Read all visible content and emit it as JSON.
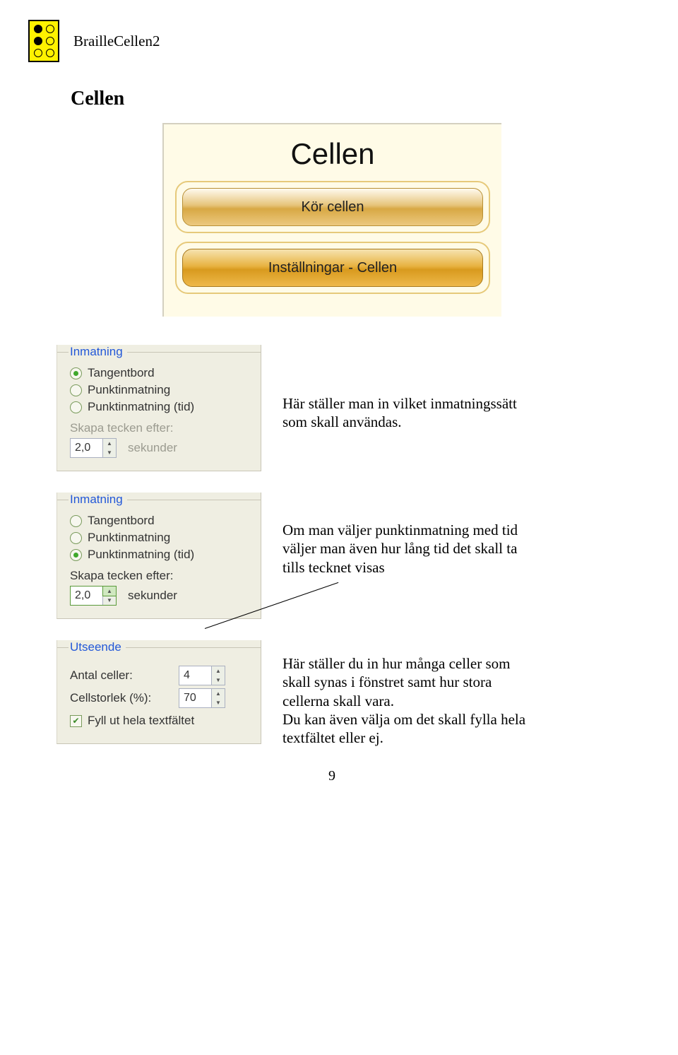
{
  "header": {
    "title": "BrailleCellen2"
  },
  "section": {
    "title": "Cellen"
  },
  "cellen_box": {
    "title": "Cellen",
    "button_run": "Kör cellen",
    "button_settings": "Inställningar - Cellen"
  },
  "panel1": {
    "group": "Inmatning",
    "opt_keyboard": "Tangentbord",
    "opt_dot": "Punktinmatning",
    "opt_dot_time": "Punktinmatning (tid)",
    "sub_label": "Skapa tecken efter:",
    "value": "2,0",
    "unit": "sekunder",
    "desc": "Här ställer man in vilket inmatningssätt som skall användas."
  },
  "panel2": {
    "group": "Inmatning",
    "opt_keyboard": "Tangentbord",
    "opt_dot": "Punktinmatning",
    "opt_dot_time": "Punktinmatning (tid)",
    "sub_label": "Skapa tecken efter:",
    "value": "2,0",
    "unit": "sekunder",
    "desc": "Om man väljer punktinmatning med tid väljer man även hur lång tid det skall ta tills tecknet visas"
  },
  "panel3": {
    "group": "Utseende",
    "cells_label": "Antal celler:",
    "cells_value": "4",
    "size_label": "Cellstorlek (%):",
    "size_value": "70",
    "fill_label": "Fyll ut hela textfältet",
    "desc": "Här ställer du in hur många celler som skall synas i fönstret samt hur stora cellerna skall vara.\nDu kan även välja om det skall fylla hela textfältet eller ej."
  },
  "pagenum": "9"
}
